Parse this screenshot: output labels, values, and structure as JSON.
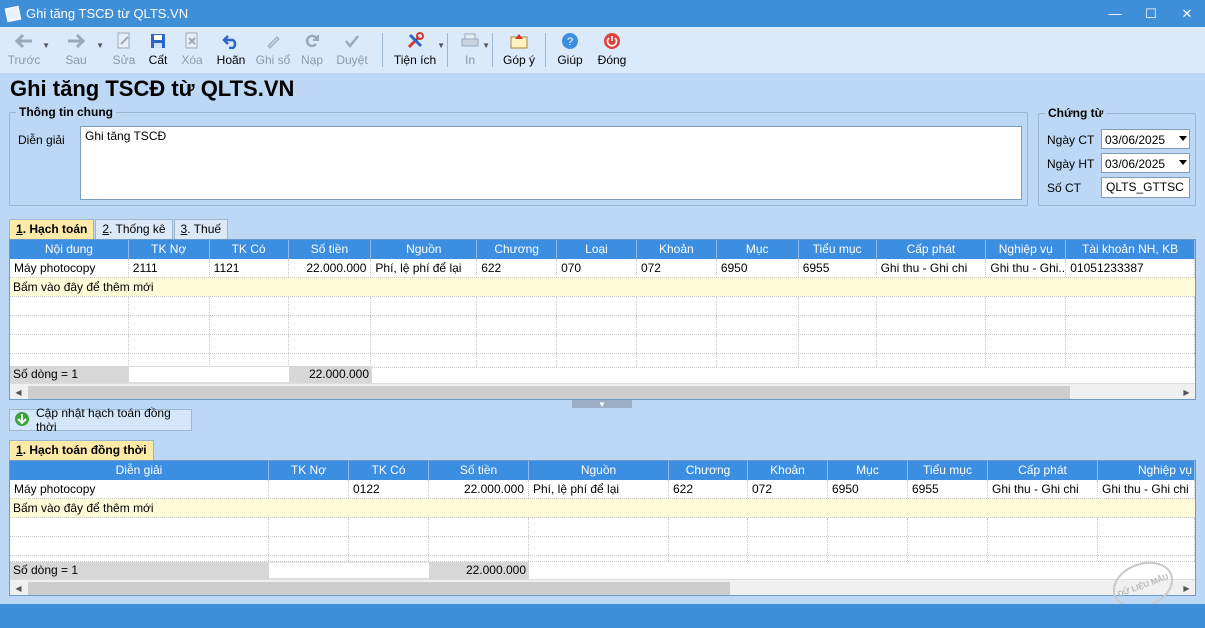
{
  "window": {
    "title": "Ghi tăng TSCĐ từ QLTS.VN",
    "minimize": "—",
    "maximize": "☐",
    "close": "✕"
  },
  "toolbar": {
    "items": [
      {
        "label": "Trước",
        "disabled": true
      },
      {
        "label": "Sau",
        "disabled": true
      },
      {
        "label": "Sửa",
        "disabled": true
      },
      {
        "label": "Cất",
        "disabled": false
      },
      {
        "label": "Xóa",
        "disabled": true
      },
      {
        "label": "Hoãn",
        "disabled": false
      },
      {
        "label": "Ghi sổ",
        "disabled": true
      },
      {
        "label": "Nạp",
        "disabled": true
      },
      {
        "label": "Duyệt",
        "disabled": true
      },
      {
        "label": "Tiện ích",
        "disabled": false
      },
      {
        "label": "In",
        "disabled": true
      },
      {
        "label": "Góp ý",
        "disabled": false
      },
      {
        "label": "Giúp",
        "disabled": false
      },
      {
        "label": "Đóng",
        "disabled": false
      }
    ]
  },
  "page": {
    "heading": "Ghi tăng TSCĐ từ QLTS.VN"
  },
  "general": {
    "group_title": "Thông tin chung",
    "desc_label": "Diễn giải",
    "desc_value": "Ghi tăng TSCĐ"
  },
  "voucher": {
    "group_title": "Chứng từ",
    "ngay_ct_label": "Ngày CT",
    "ngay_ct_value": "03/06/2025",
    "ngay_ht_label": "Ngày HT",
    "ngay_ht_value": "03/06/2025",
    "so_ct_label": "Số CT",
    "so_ct_value": "QLTS_GTTSC"
  },
  "tabs1": [
    {
      "num": "1",
      "label": ". Hạch toán"
    },
    {
      "num": "2",
      "label": ". Thống kê"
    },
    {
      "num": "3",
      "label": ". Thuế"
    }
  ],
  "grid1": {
    "columns": [
      "Nội dung",
      "TK Nợ",
      "TK Có",
      "Số tiền",
      "Nguồn",
      "Chương",
      "Loại",
      "Khoản",
      "Mục",
      "Tiểu mục",
      "Cấp phát",
      "Nghiệp vụ",
      "Tài khoản NH, KB"
    ],
    "row": [
      "Máy photocopy",
      "2111",
      "1121",
      "22.000.000",
      "Phí, lệ phí để lại",
      "622",
      "070",
      "072",
      "6950",
      "6955",
      "Ghi thu - Ghi chi",
      "Ghi thu - Ghi...",
      "01051233387"
    ],
    "add_row": "Bấm vào đây để thêm mới",
    "footer_count": "Số dòng = 1",
    "footer_total": "22.000.000"
  },
  "update_button": {
    "label": "Cập nhật hạch toán đồng thời"
  },
  "tabs2": [
    {
      "num": "1",
      "label": ". Hạch toán đồng thời"
    }
  ],
  "grid2": {
    "columns": [
      "Diễn giải",
      "TK Nợ",
      "TK Có",
      "Số tiền",
      "Nguồn",
      "Chương",
      "Khoản",
      "Mục",
      "Tiểu mục",
      "Cấp phát",
      "Nghiệp vụ"
    ],
    "row": [
      "Máy photocopy",
      "",
      "0122",
      "22.000.000",
      "Phí, lệ phí để lại",
      "622",
      "072",
      "6950",
      "6955",
      "Ghi thu - Ghi chi",
      "Ghi thu - Ghi chi"
    ],
    "add_row": "Bấm vào đây để thêm mới",
    "footer_count": "Số dòng = 1",
    "footer_total": "22.000.000"
  },
  "watermark": {
    "text": "DỮ LIỆU MẪU"
  },
  "colors": {
    "titlebar": "#3f8fd8",
    "header": "#3b8ee0",
    "background": "#bcd8f5",
    "active_tab": "#fde9a8"
  }
}
